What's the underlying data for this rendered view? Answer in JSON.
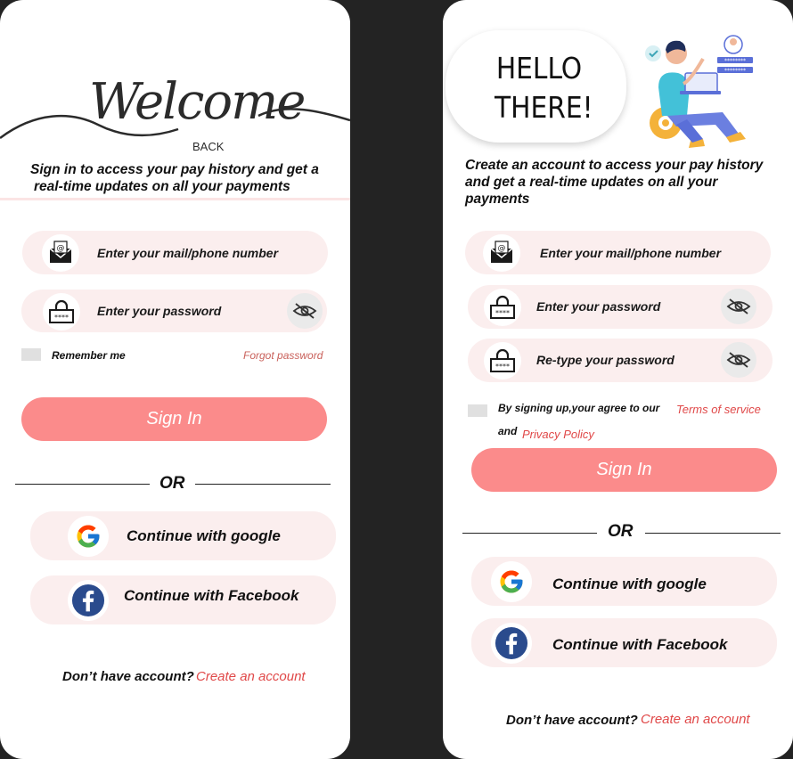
{
  "login": {
    "welcome_script": "Welcome",
    "back_label": "BACK",
    "subtitle_line1": "Sign in to access your pay history and get a",
    "subtitle_line2": "real-time updates on all your payments",
    "email_placeholder": "Enter your mail/phone number",
    "password_placeholder": "Enter your password",
    "remember_label": "Remember  me",
    "forgot_label": "Forgot password",
    "signin_label": "Sign In",
    "or_label": "OR",
    "google_label": "Continue with google",
    "facebook_label": "Continue with Facebook",
    "no_account_label": "Don’t have account?",
    "create_account_label": "Create an account"
  },
  "signup": {
    "hello_line1": "HELLO",
    "hello_line2": "THERE!",
    "subtitle": "Create an account to access your pay history and get a real-time updates on all your payments",
    "email_placeholder": "Enter your mail/phone number",
    "password_placeholder": "Enter your password",
    "retype_placeholder": "Re-type  your password",
    "agree_text": "By signing up,your agree to our",
    "terms_label": "Terms of  service",
    "and_label": "and",
    "privacy_label": "Privacy Policy",
    "signin_label": "Sign In",
    "or_label": "OR",
    "google_label": "Continue with google",
    "facebook_label": "Continue with Facebook",
    "no_account_label": "Don’t have account?",
    "create_account_label": "Create an account"
  },
  "icons": {
    "email": "email-at-envelope-icon",
    "password": "padlock-icon",
    "eye": "eye-hidden-icon",
    "google": "google-g-icon",
    "facebook": "facebook-f-icon"
  },
  "colors": {
    "background": "#232323",
    "card": "#ffffff",
    "pill": "#fbeeee",
    "primary_button": "#fb8b8b",
    "link": "#e04848",
    "forgot_link": "#c9605a"
  }
}
